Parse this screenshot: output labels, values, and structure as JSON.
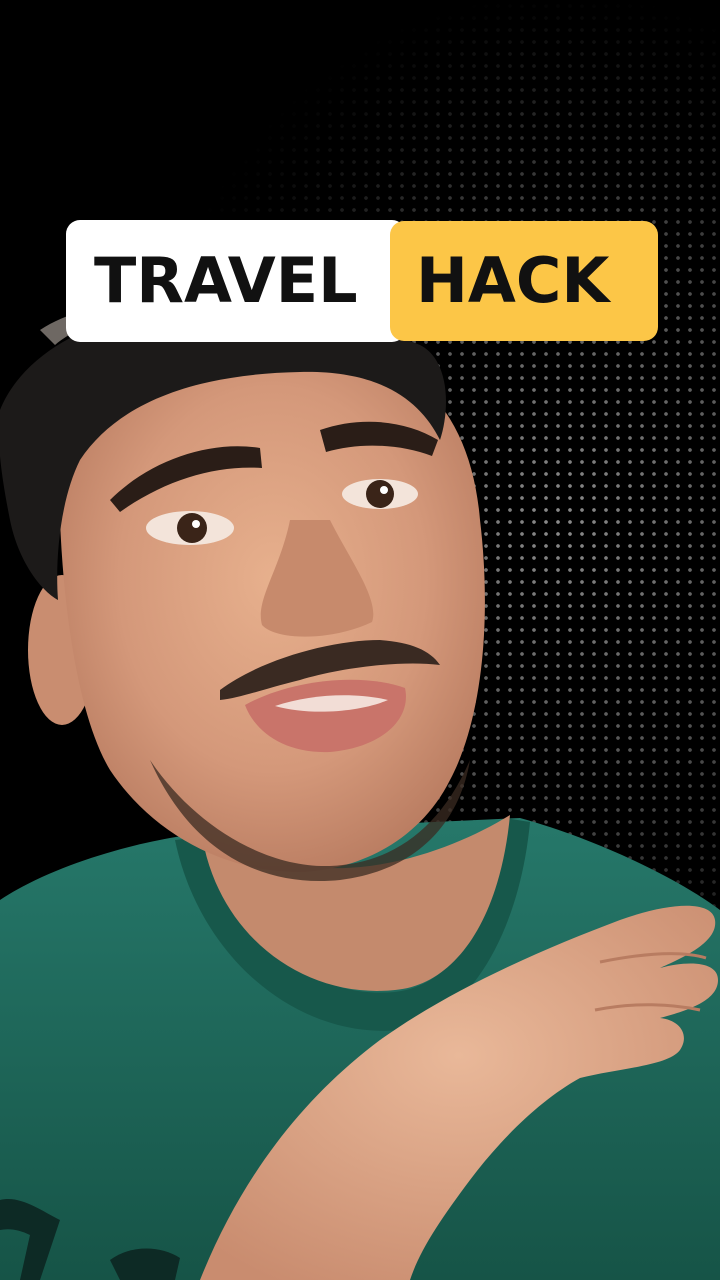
{
  "video": {
    "title_words": [
      "TRAVEL",
      "HACK"
    ]
  },
  "colors": {
    "background": "#000000",
    "title_primary_bg": "#ffffff",
    "title_accent_bg": "#fcc647",
    "title_text": "#111111",
    "shirt": "#1f6a5c"
  },
  "icons": []
}
